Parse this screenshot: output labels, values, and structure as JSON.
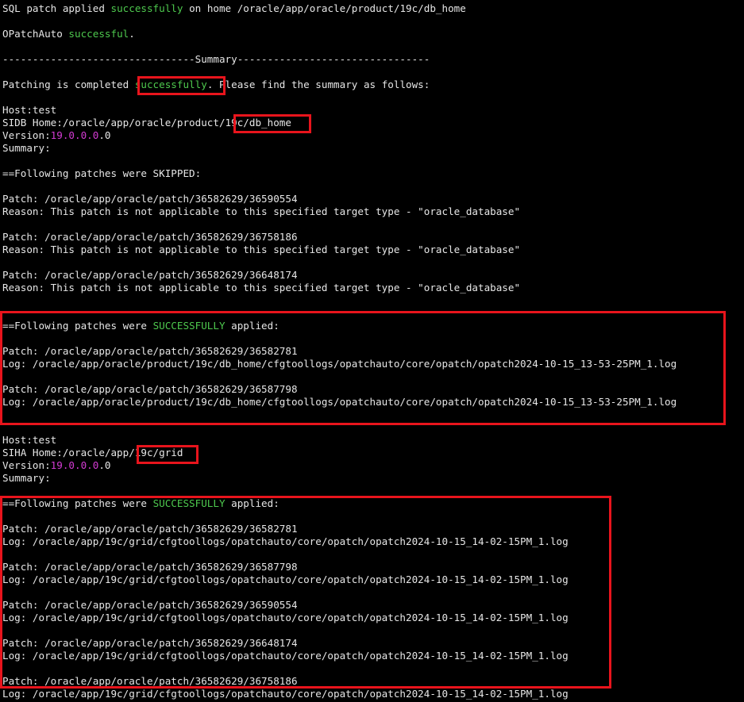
{
  "terminal": {
    "colors": {
      "background": "#000000",
      "text": "#e6e6e6",
      "success_green": "#4ec94e",
      "version_magenta": "#d33bd3",
      "highlight_red": "#e8141c"
    },
    "lines": [
      {
        "segments": [
          {
            "text": "SQL patch applied ",
            "style": "normal"
          },
          {
            "text": "successfully",
            "style": "green"
          },
          {
            "text": " on home /oracle/app/oracle/product/19c/db_home",
            "style": "normal"
          }
        ]
      },
      {
        "segments": []
      },
      {
        "segments": [
          {
            "text": "OPatchAuto ",
            "style": "normal"
          },
          {
            "text": "successful",
            "style": "green"
          },
          {
            "text": ".",
            "style": "normal"
          }
        ]
      },
      {
        "segments": []
      },
      {
        "segments": [
          {
            "text": "--------------------------------Summary--------------------------------",
            "style": "normal"
          }
        ]
      },
      {
        "segments": []
      },
      {
        "segments": [
          {
            "text": "Patching is completed ",
            "style": "normal"
          },
          {
            "text": "successfully",
            "style": "green"
          },
          {
            "text": ". Please find the summary as follows:",
            "style": "normal"
          }
        ]
      },
      {
        "segments": []
      },
      {
        "segments": [
          {
            "text": "Host:test",
            "style": "normal"
          }
        ]
      },
      {
        "segments": [
          {
            "text": "SIDB Home:/oracle/app/oracle/product/19c/db_home",
            "style": "normal"
          }
        ]
      },
      {
        "segments": [
          {
            "text": "Version:",
            "style": "normal"
          },
          {
            "text": "19.0.0.0",
            "style": "magenta"
          },
          {
            "text": ".0",
            "style": "normal"
          }
        ]
      },
      {
        "segments": [
          {
            "text": "Summary:",
            "style": "normal"
          }
        ]
      },
      {
        "segments": []
      },
      {
        "segments": [
          {
            "text": "==Following patches were SKIPPED:",
            "style": "normal"
          }
        ]
      },
      {
        "segments": []
      },
      {
        "segments": [
          {
            "text": "Patch: /oracle/app/oracle/patch/36582629/36590554",
            "style": "normal"
          }
        ]
      },
      {
        "segments": [
          {
            "text": "Reason: This patch is not applicable to this specified target type - \"oracle_database\"",
            "style": "normal"
          }
        ]
      },
      {
        "segments": []
      },
      {
        "segments": [
          {
            "text": "Patch: /oracle/app/oracle/patch/36582629/36758186",
            "style": "normal"
          }
        ]
      },
      {
        "segments": [
          {
            "text": "Reason: This patch is not applicable to this specified target type - \"oracle_database\"",
            "style": "normal"
          }
        ]
      },
      {
        "segments": []
      },
      {
        "segments": [
          {
            "text": "Patch: /oracle/app/oracle/patch/36582629/36648174",
            "style": "normal"
          }
        ]
      },
      {
        "segments": [
          {
            "text": "Reason: This patch is not applicable to this specified target type - \"oracle_database\"",
            "style": "normal"
          }
        ]
      },
      {
        "segments": []
      },
      {
        "segments": []
      },
      {
        "segments": [
          {
            "text": "==Following patches were ",
            "style": "normal"
          },
          {
            "text": "SUCCESSFULLY",
            "style": "green"
          },
          {
            "text": " applied:",
            "style": "normal"
          }
        ]
      },
      {
        "segments": []
      },
      {
        "segments": [
          {
            "text": "Patch: /oracle/app/oracle/patch/36582629/36582781",
            "style": "normal"
          }
        ]
      },
      {
        "segments": [
          {
            "text": "Log: /oracle/app/oracle/product/19c/db_home/cfgtoollogs/opatchauto/core/opatch/opatch2024-10-15_13-53-25PM_1.log",
            "style": "normal"
          }
        ]
      },
      {
        "segments": []
      },
      {
        "segments": [
          {
            "text": "Patch: /oracle/app/oracle/patch/36582629/36587798",
            "style": "normal"
          }
        ]
      },
      {
        "segments": [
          {
            "text": "Log: /oracle/app/oracle/product/19c/db_home/cfgtoollogs/opatchauto/core/opatch/opatch2024-10-15_13-53-25PM_1.log",
            "style": "normal"
          }
        ]
      },
      {
        "segments": []
      },
      {
        "segments": []
      },
      {
        "segments": [
          {
            "text": "Host:test",
            "style": "normal"
          }
        ]
      },
      {
        "segments": [
          {
            "text": "SIHA Home:/oracle/app/19c/grid",
            "style": "normal"
          }
        ]
      },
      {
        "segments": [
          {
            "text": "Version:",
            "style": "normal"
          },
          {
            "text": "19.0.0.0",
            "style": "magenta"
          },
          {
            "text": ".0",
            "style": "normal"
          }
        ]
      },
      {
        "segments": [
          {
            "text": "Summary:",
            "style": "normal"
          }
        ]
      },
      {
        "segments": []
      },
      {
        "segments": [
          {
            "text": "==Following patches were ",
            "style": "normal"
          },
          {
            "text": "SUCCESSFULLY",
            "style": "green"
          },
          {
            "text": " applied:",
            "style": "normal"
          }
        ]
      },
      {
        "segments": []
      },
      {
        "segments": [
          {
            "text": "Patch: /oracle/app/oracle/patch/36582629/36582781",
            "style": "normal"
          }
        ]
      },
      {
        "segments": [
          {
            "text": "Log: /oracle/app/19c/grid/cfgtoollogs/opatchauto/core/opatch/opatch2024-10-15_14-02-15PM_1.log",
            "style": "normal"
          }
        ]
      },
      {
        "segments": []
      },
      {
        "segments": [
          {
            "text": "Patch: /oracle/app/oracle/patch/36582629/36587798",
            "style": "normal"
          }
        ]
      },
      {
        "segments": [
          {
            "text": "Log: /oracle/app/19c/grid/cfgtoollogs/opatchauto/core/opatch/opatch2024-10-15_14-02-15PM_1.log",
            "style": "normal"
          }
        ]
      },
      {
        "segments": []
      },
      {
        "segments": [
          {
            "text": "Patch: /oracle/app/oracle/patch/36582629/36590554",
            "style": "normal"
          }
        ]
      },
      {
        "segments": [
          {
            "text": "Log: /oracle/app/19c/grid/cfgtoollogs/opatchauto/core/opatch/opatch2024-10-15_14-02-15PM_1.log",
            "style": "normal"
          }
        ]
      },
      {
        "segments": []
      },
      {
        "segments": [
          {
            "text": "Patch: /oracle/app/oracle/patch/36582629/36648174",
            "style": "normal"
          }
        ]
      },
      {
        "segments": [
          {
            "text": "Log: /oracle/app/19c/grid/cfgtoollogs/opatchauto/core/opatch/opatch2024-10-15_14-02-15PM_1.log",
            "style": "normal"
          }
        ]
      },
      {
        "segments": []
      },
      {
        "segments": [
          {
            "text": "Patch: /oracle/app/oracle/patch/36582629/36758186",
            "style": "normal"
          }
        ]
      },
      {
        "segments": [
          {
            "text": "Log: /oracle/app/19c/grid/cfgtoollogs/opatchauto/core/opatch/opatch2024-10-15_14-02-15PM_1.log",
            "style": "normal"
          }
        ]
      }
    ]
  }
}
